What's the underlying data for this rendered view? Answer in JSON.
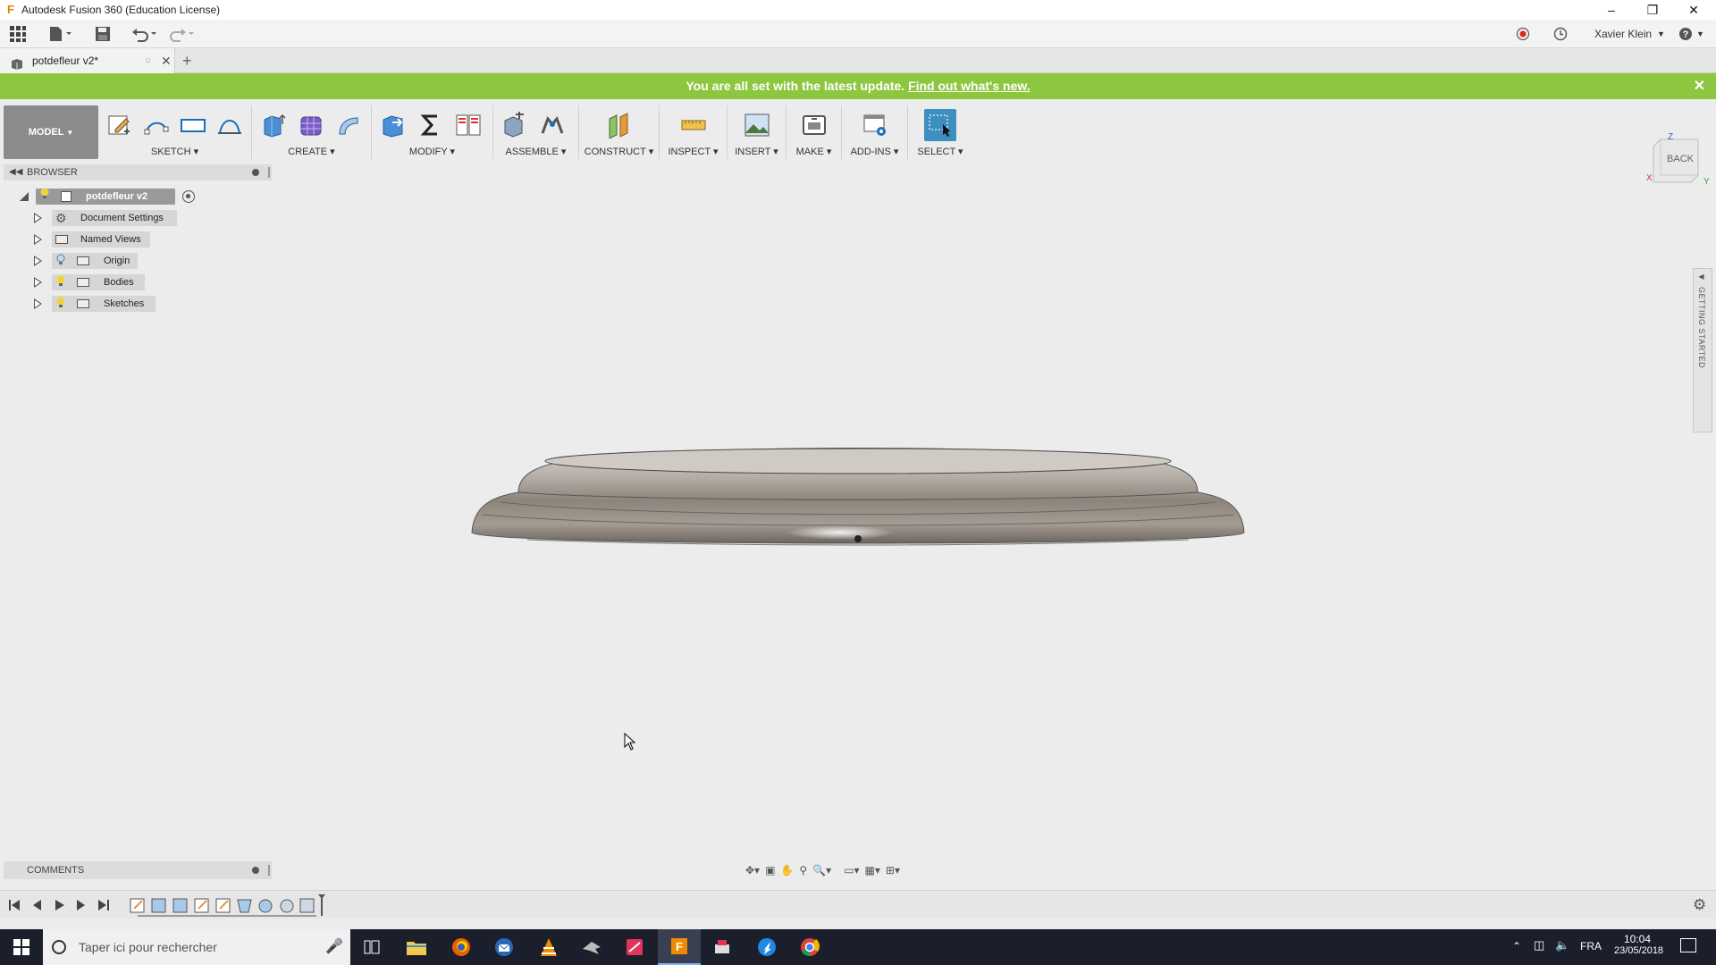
{
  "window": {
    "title": "Autodesk Fusion 360 (Education License)"
  },
  "qat": {
    "user_name": "Xavier Klein"
  },
  "document_tab": {
    "label": "potdefleur v2*"
  },
  "banner": {
    "text": "You are all set with the latest update.",
    "link": "Find out what's new."
  },
  "toolbar": {
    "workspace": "MODEL",
    "groups": {
      "sketch": "SKETCH",
      "create": "CREATE",
      "modify": "MODIFY",
      "assemble": "ASSEMBLE",
      "construct": "CONSTRUCT",
      "inspect": "INSPECT",
      "insert": "INSERT",
      "make": "MAKE",
      "addins": "ADD-INS",
      "select": "SELECT"
    }
  },
  "browser": {
    "title": "BROWSER",
    "root": "potdefleur v2",
    "items": [
      "Document Settings",
      "Named Views",
      "Origin",
      "Bodies",
      "Sketches"
    ]
  },
  "viewcube": {
    "face": "BACK",
    "axis_x": "X",
    "axis_y": "Y",
    "axis_z": "Z"
  },
  "getting_started": "GETTING STARTED",
  "comments": {
    "title": "COMMENTS"
  },
  "taskbar": {
    "search_placeholder": "Taper ici pour rechercher",
    "lang": "FRA",
    "time": "10:04",
    "date": "23/05/2018"
  },
  "colors": {
    "banner": "#8dc63f",
    "workspace_button": "#8b8b8b",
    "taskbar": "#1a1f2b",
    "select_active": "#3c8fbf"
  }
}
